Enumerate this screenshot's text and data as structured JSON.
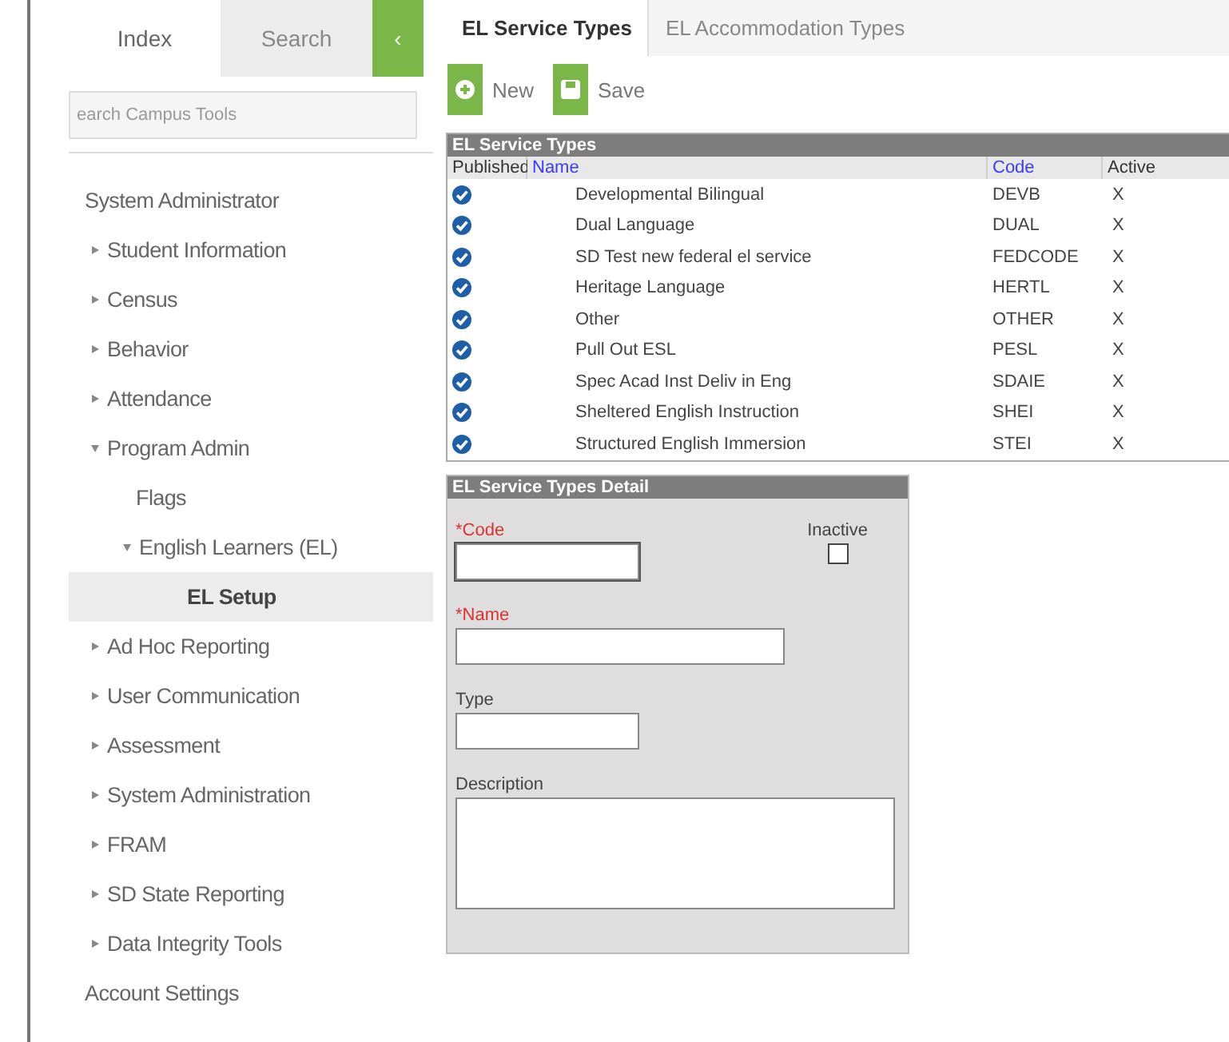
{
  "sidebar": {
    "tabs": [
      {
        "label": "Index",
        "selected": true
      },
      {
        "label": "Search",
        "selected": false
      }
    ],
    "collapse_button": "‹",
    "search": {
      "placeholder": "earch Campus Tools"
    },
    "tree": [
      {
        "label": "System Administrator",
        "kind": "plain",
        "selected": false
      },
      {
        "label": "Student Information",
        "kind": "folder",
        "expanded": false,
        "selected": false
      },
      {
        "label": "Census",
        "kind": "folder",
        "expanded": false,
        "selected": false
      },
      {
        "label": "Behavior",
        "kind": "folder",
        "expanded": false,
        "selected": false
      },
      {
        "label": "Attendance",
        "kind": "folder",
        "expanded": false,
        "selected": false
      },
      {
        "label": "Program Admin",
        "kind": "folder",
        "expanded": true,
        "selected": false,
        "children": [
          {
            "label": "Flags",
            "kind": "plain",
            "selected": false
          },
          {
            "label": "English Learners (EL)",
            "kind": "folder",
            "expanded": true,
            "selected": false,
            "children": [
              {
                "label": "EL Setup",
                "kind": "plain",
                "selected": true
              }
            ]
          }
        ]
      },
      {
        "label": "Ad Hoc Reporting",
        "kind": "folder",
        "expanded": false,
        "selected": false
      },
      {
        "label": "User Communication",
        "kind": "folder",
        "expanded": false,
        "selected": false
      },
      {
        "label": "Assessment",
        "kind": "folder",
        "expanded": false,
        "selected": false
      },
      {
        "label": "System Administration",
        "kind": "folder",
        "expanded": false,
        "selected": false
      },
      {
        "label": "FRAM",
        "kind": "folder",
        "expanded": false,
        "selected": false
      },
      {
        "label": "SD State Reporting",
        "kind": "folder",
        "expanded": false,
        "selected": false
      },
      {
        "label": "Data Integrity Tools",
        "kind": "folder",
        "expanded": false,
        "selected": false
      },
      {
        "label": "Account Settings",
        "kind": "plain",
        "selected": false
      }
    ]
  },
  "tabs": [
    {
      "label": "EL Service Types",
      "selected": true
    },
    {
      "label": "EL Accommodation Types",
      "selected": false
    }
  ],
  "toolbar": [
    {
      "label": "New",
      "kind": "new"
    },
    {
      "label": "Save",
      "kind": "save"
    }
  ],
  "table": {
    "title": "EL Service Types",
    "columns": [
      {
        "label": "Published",
        "sortable": false
      },
      {
        "label": "Name",
        "sortable": true
      },
      {
        "label": "Code",
        "sortable": true
      },
      {
        "label": "Active",
        "sortable": false
      }
    ],
    "rows": [
      {
        "published": true,
        "name": "Developmental Bilingual",
        "code": "DEVB",
        "active": "X"
      },
      {
        "published": true,
        "name": "Dual Language",
        "code": "DUAL",
        "active": "X"
      },
      {
        "published": true,
        "name": "SD Test new  federal el service",
        "code": "FEDCODE",
        "active": "X"
      },
      {
        "published": true,
        "name": "Heritage Language",
        "code": "HERTL",
        "active": "X"
      },
      {
        "published": true,
        "name": "Other",
        "code": "OTHER",
        "active": "X"
      },
      {
        "published": true,
        "name": "Pull Out ESL",
        "code": "PESL",
        "active": "X"
      },
      {
        "published": true,
        "name": "Spec Acad Inst Deliv in Eng",
        "code": "SDAIE",
        "active": "X"
      },
      {
        "published": true,
        "name": "Sheltered English Instruction",
        "code": "SHEI",
        "active": "X"
      },
      {
        "published": true,
        "name": "Structured English Immersion",
        "code": "STEI",
        "active": "X"
      }
    ]
  },
  "detail": {
    "title": "EL Service Types Detail",
    "code": {
      "label": "*Code",
      "required": true,
      "focused": true
    },
    "inactive": {
      "label": "Inactive",
      "checked": false
    },
    "name": {
      "label": "*Name",
      "required": true
    },
    "type": {
      "label": "Type",
      "required": false
    },
    "description": {
      "label": "Description",
      "required": false
    }
  }
}
